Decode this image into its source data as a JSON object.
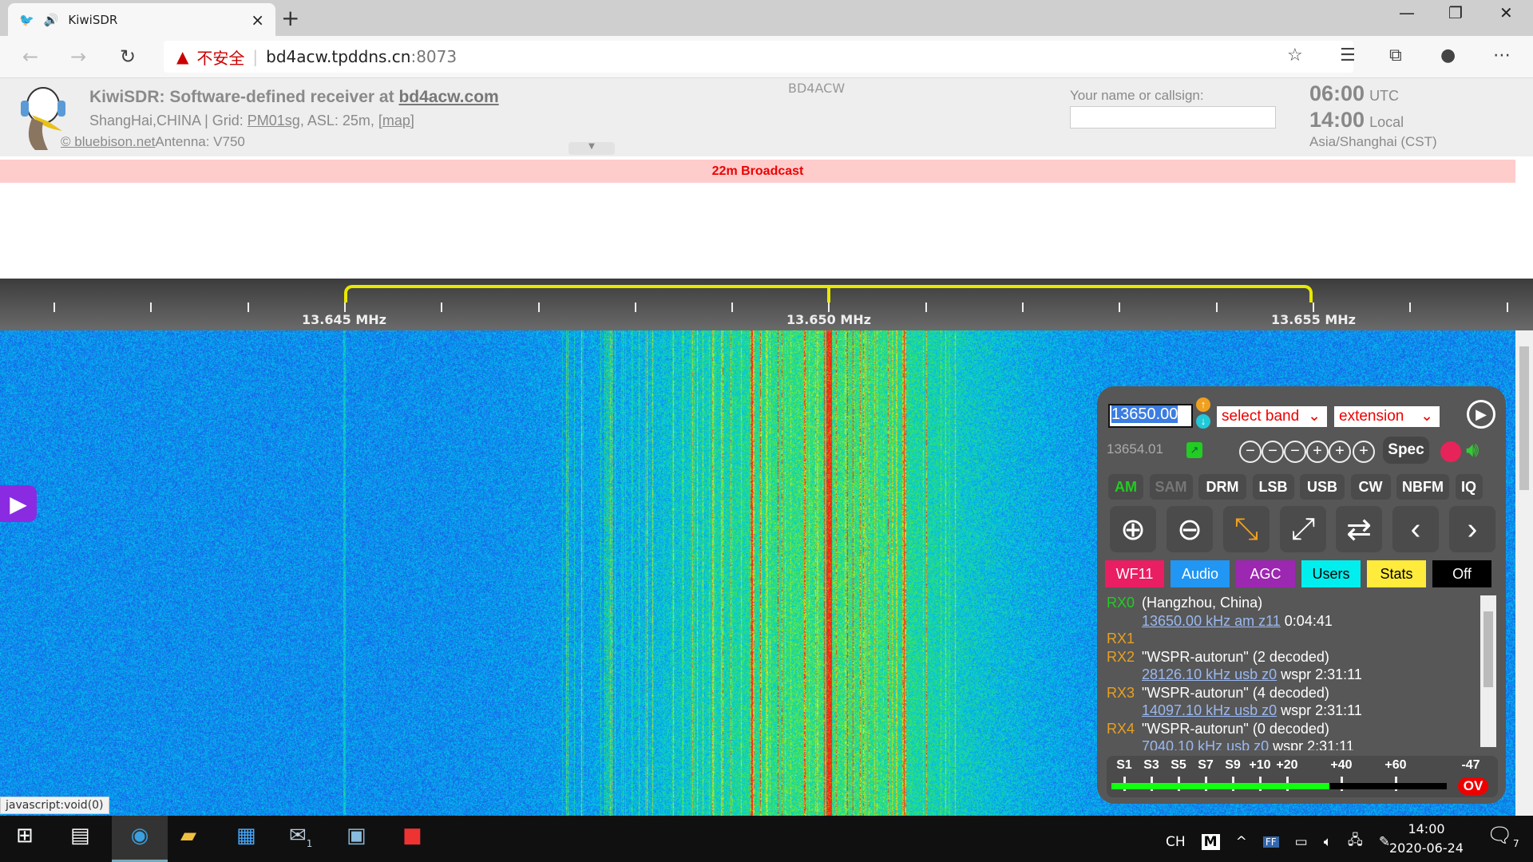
{
  "browser": {
    "tab_title": "KiwiSDR",
    "new_tab": "+",
    "tab_close": "×",
    "security_warning": "不安全",
    "url_host": "bd4acw.tpddns.cn",
    "url_port": ":8073"
  },
  "header": {
    "title_prefix": "KiwiSDR: Software-defined receiver at ",
    "title_link": "bd4acw.com",
    "location": "ShangHai,CHINA | Grid: ",
    "grid": "PM01sg",
    "asl": ", ASL: 25m, ",
    "map_link": "[map]",
    "credit_link": "© bluebison.net",
    "antenna": "Antenna: V750",
    "callsign": "BD4ACW",
    "name_label": "Your name or callsign:",
    "name_value": "",
    "utc_time": "06:00",
    "utc_label": "UTC",
    "local_time": "14:00",
    "local_label": "Local",
    "timezone": "Asia/Shanghai (CST)"
  },
  "band_bar": "22m Broadcast",
  "scale": {
    "labels": [
      "13.645 MHz",
      "13.650 MHz",
      "13.655 MHz"
    ]
  },
  "status_bar": "javascript:void(0)",
  "panel": {
    "frequency": "13650.00",
    "select_band": "select band",
    "extension": "extension",
    "secondary_freq": "13654.01",
    "spec": "Spec",
    "modes": [
      {
        "label": "AM",
        "color": "#22cc22"
      },
      {
        "label": "SAM",
        "color": "#777777"
      },
      {
        "label": "DRM",
        "color": "#ffffff"
      },
      {
        "label": "LSB",
        "color": "#ffffff"
      },
      {
        "label": "USB",
        "color": "#ffffff"
      },
      {
        "label": "CW",
        "color": "#ffffff"
      },
      {
        "label": "NBFM",
        "color": "#ffffff"
      },
      {
        "label": "IQ",
        "color": "#ffffff"
      }
    ],
    "control_tabs": [
      {
        "label": "WF11",
        "bg": "#e91e63",
        "fg": "#ffffff"
      },
      {
        "label": "Audio",
        "bg": "#2196f3",
        "fg": "#ffffff"
      },
      {
        "label": "AGC",
        "bg": "#9c27b0",
        "fg": "#ffffff"
      },
      {
        "label": "Users",
        "bg": "#00eeee",
        "fg": "#000000"
      },
      {
        "label": "Stats",
        "bg": "#ffeb3b",
        "fg": "#000000"
      },
      {
        "label": "Off",
        "bg": "#000000",
        "fg": "#ffffff"
      }
    ],
    "users": [
      {
        "rx": "RX0",
        "name": "(Hangzhou, China)",
        "link": "13650.00 kHz am z11",
        "info": "0:04:41"
      },
      {
        "rx": "RX1",
        "name": "",
        "link": "",
        "info": ""
      },
      {
        "rx": "RX2",
        "name": "\"WSPR-autorun\" (2 decoded)",
        "link": "28126.10 kHz usb z0",
        "info": "wspr 2:31:11"
      },
      {
        "rx": "RX3",
        "name": "\"WSPR-autorun\" (4 decoded)",
        "link": "14097.10 kHz usb z0",
        "info": "wspr 2:31:11"
      },
      {
        "rx": "RX4",
        "name": "\"WSPR-autorun\" (0 decoded)",
        "link": "7040.10 kHz usb z0",
        "info": "wspr 2:31:11"
      }
    ],
    "smeter": {
      "labels": [
        "S1",
        "S3",
        "S5",
        "S7",
        "S9",
        "+10",
        "+20",
        "+40",
        "+60"
      ],
      "reading": "-47",
      "overload": "OV",
      "level_fraction": 0.65
    }
  },
  "taskbar": {
    "ime": "CH",
    "ime2": "M",
    "time": "14:00",
    "date": "2020-06-24",
    "notifications": "7",
    "mail_badge": "1"
  }
}
